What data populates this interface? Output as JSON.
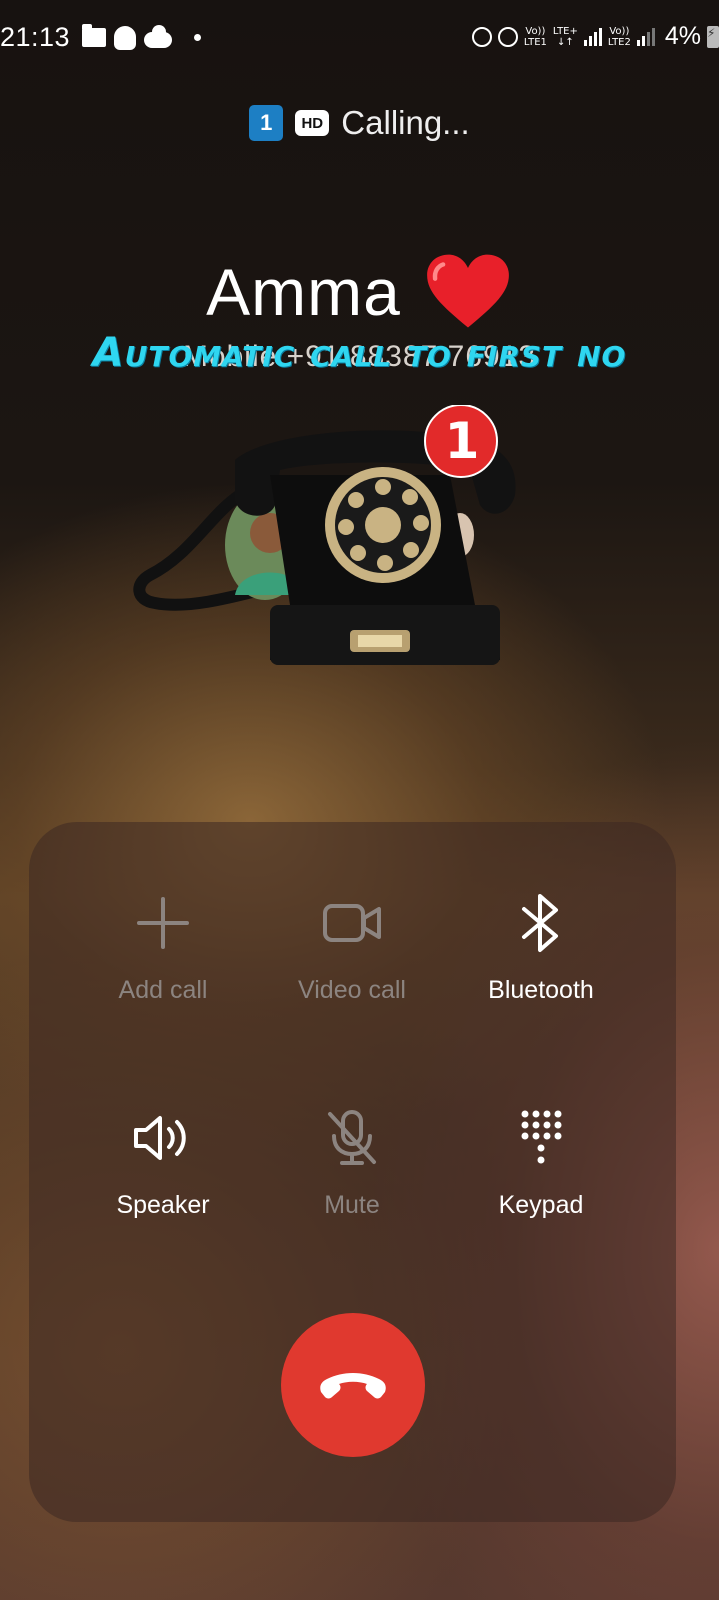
{
  "status_bar": {
    "time": "21:13",
    "lte1_top": "Vo))",
    "lte1_bottom": "LTE1",
    "lte_plus": "LTE+",
    "lte_arrows": "↓↑",
    "lte2_top": "Vo))",
    "lte2_bottom": "LTE2",
    "battery": "4%",
    "left_icons": [
      "folder-icon",
      "snapchat-icon",
      "cloud-icon",
      "dot-icon"
    ],
    "right_icons": [
      "lock-icon",
      "alarm-icon",
      "signal-icon",
      "battery-charging-icon"
    ]
  },
  "header": {
    "sim": "1",
    "hd": "HD",
    "status": "Calling..."
  },
  "caller": {
    "name": "Amma",
    "number": "Mobile +91 88387 76913",
    "heart_color": "#e8202a"
  },
  "overlay": {
    "caption": "Automatic call to first no"
  },
  "phone_art": {
    "badge": "1"
  },
  "controls": {
    "add_call": "Add call",
    "video_call": "Video call",
    "bluetooth": "Bluetooth",
    "speaker": "Speaker",
    "mute": "Mute",
    "keypad": "Keypad"
  },
  "colors": {
    "end_call": "#e0392f",
    "overlay_text": "#2fd6f0",
    "sim_badge": "#1d7fc4"
  }
}
